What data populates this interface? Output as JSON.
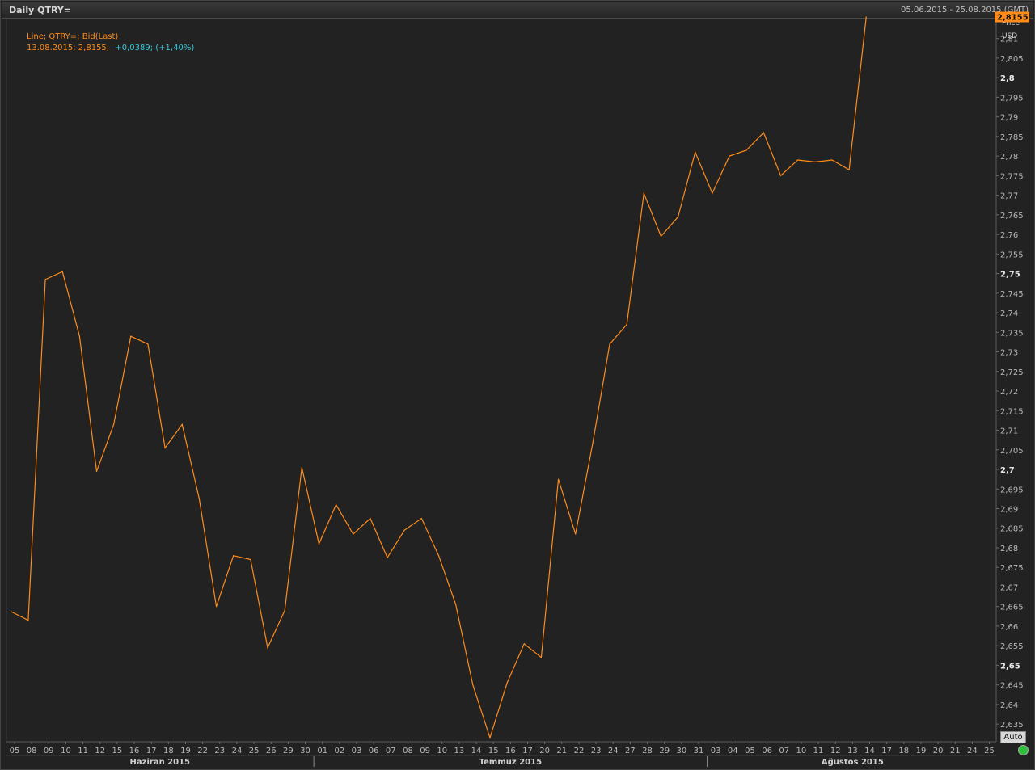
{
  "header": {
    "title": "Daily QTRY=",
    "range": "05.06.2015 - 25.08.2015 (GMT)"
  },
  "legend": {
    "line1": "Line; QTRY=; Bid(Last)",
    "date_value": "13.08.2015; 2,8155;",
    "change": "+0,0389; (+1,40%)"
  },
  "axis": {
    "unit_top": "Price",
    "unit": "USD",
    "last_price_label": "2,8155",
    "auto_label": "Auto"
  },
  "colors": {
    "line": "#ff8c1a",
    "change_text": "#33ccdd",
    "background": "#222222",
    "price_tag": "#ff8c1a"
  },
  "chart_data": {
    "type": "line",
    "title": "Daily QTRY=",
    "ylabel": "Price USD",
    "ylim": [
      2.6305,
      2.8155
    ],
    "y_ticks": [
      "2,635",
      "2,64",
      "2,645",
      "2,65",
      "2,655",
      "2,66",
      "2,665",
      "2,67",
      "2,675",
      "2,68",
      "2,685",
      "2,69",
      "2,695",
      "2,7",
      "2,705",
      "2,71",
      "2,715",
      "2,72",
      "2,725",
      "2,73",
      "2,735",
      "2,74",
      "2,745",
      "2,75",
      "2,755",
      "2,76",
      "2,765",
      "2,77",
      "2,775",
      "2,78",
      "2,785",
      "2,79",
      "2,795",
      "2,8",
      "2,805",
      "2,81"
    ],
    "y_tick_values": [
      2.635,
      2.64,
      2.645,
      2.65,
      2.655,
      2.66,
      2.665,
      2.67,
      2.675,
      2.68,
      2.685,
      2.69,
      2.695,
      2.7,
      2.705,
      2.71,
      2.715,
      2.72,
      2.725,
      2.73,
      2.735,
      2.74,
      2.745,
      2.75,
      2.755,
      2.76,
      2.765,
      2.77,
      2.775,
      2.78,
      2.785,
      2.79,
      2.795,
      2.8,
      2.805,
      2.81
    ],
    "bold_ticks": [
      "2,65",
      "2,7",
      "2,75",
      "2,8"
    ],
    "x_labels": [
      "05",
      "08",
      "09",
      "10",
      "11",
      "12",
      "15",
      "16",
      "17",
      "18",
      "19",
      "22",
      "23",
      "24",
      "25",
      "26",
      "29",
      "30",
      "01",
      "02",
      "03",
      "06",
      "07",
      "08",
      "09",
      "10",
      "13",
      "14",
      "15",
      "16",
      "17",
      "20",
      "21",
      "22",
      "23",
      "24",
      "27",
      "28",
      "29",
      "30",
      "31",
      "03",
      "04",
      "05",
      "06",
      "07",
      "10",
      "11",
      "12",
      "13",
      "14",
      "17",
      "18",
      "19",
      "20",
      "21",
      "24",
      "25"
    ],
    "months": [
      {
        "label": "Haziran 2015",
        "start": 0,
        "end": 17
      },
      {
        "label": "Temmuz 2015",
        "start": 18,
        "end": 40
      },
      {
        "label": "Ağustos 2015",
        "start": 41,
        "end": 57
      }
    ],
    "series": [
      {
        "name": "QTRY=; Bid(Last)",
        "x_start": -0.2,
        "values": [
          2.6637,
          2.6615,
          2.7485,
          2.7505,
          2.734,
          2.6995,
          2.7115,
          2.734,
          2.732,
          2.7055,
          2.7115,
          2.6925,
          2.665,
          2.678,
          2.677,
          2.6545,
          2.664,
          2.7005,
          2.681,
          2.691,
          2.6835,
          2.6875,
          2.6775,
          2.6845,
          2.6875,
          2.678,
          2.6655,
          2.645,
          2.6315,
          2.6455,
          2.6555,
          2.652,
          2.6975,
          2.6835,
          2.7065,
          2.732,
          2.737,
          2.7705,
          2.7595,
          2.7645,
          2.781,
          2.7705,
          2.78,
          2.7815,
          2.786,
          2.775,
          2.779,
          2.7785,
          2.779,
          2.7765,
          2.8155
        ]
      }
    ],
    "grid": false,
    "legend_position": "top-left"
  }
}
